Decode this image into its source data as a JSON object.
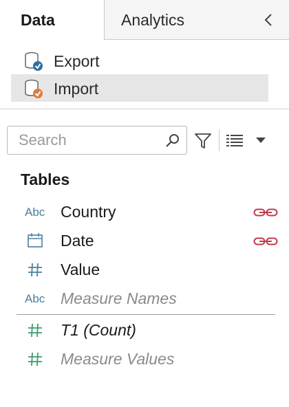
{
  "tabs": {
    "data_label": "Data",
    "analytics_label": "Analytics"
  },
  "data_sources": [
    {
      "label": "Export",
      "icon": "database-check-icon",
      "status_color": "#2e6fa3"
    },
    {
      "label": "Import",
      "icon": "database-check-icon",
      "status_color": "#e07b39",
      "selected": true
    }
  ],
  "search": {
    "placeholder": "Search",
    "value": ""
  },
  "tables": {
    "heading": "Tables",
    "fields": [
      {
        "type_icon": "Abc",
        "label": "Country",
        "role": "dimension",
        "linked": true
      },
      {
        "type_icon": "calendar-icon",
        "label": "Date",
        "role": "dimension",
        "linked": true
      },
      {
        "type_icon": "number-hash-icon",
        "label": "Value",
        "role": "dimension",
        "linked": false
      },
      {
        "type_icon": "Abc",
        "label": "Measure Names",
        "role": "generated",
        "linked": false
      }
    ],
    "measures": [
      {
        "type_icon": "number-hash-icon",
        "label": "T1 (Count)",
        "role": "measure"
      },
      {
        "type_icon": "number-hash-icon",
        "label": "Measure Values",
        "role": "generated"
      }
    ]
  },
  "colors": {
    "link_red": "#c0394b",
    "dimension_blue": "#4a7f9e",
    "measure_green": "#3a9a6e",
    "selected_bg": "#e6e6e6"
  }
}
